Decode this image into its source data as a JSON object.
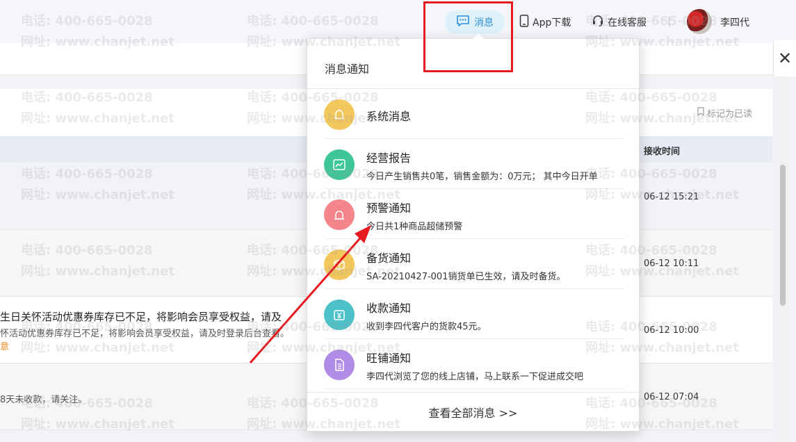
{
  "topbar": {
    "message_label": "消息",
    "app_label": "App下载",
    "service_label": "在线客服",
    "username": "李四代"
  },
  "page": {
    "mark_read": "标记为已读",
    "col_time": "接收时间",
    "rows": [
      {
        "title": "",
        "desc": "",
        "link": "",
        "time": "06-12 15:21"
      },
      {
        "title": "",
        "desc": "",
        "link": "",
        "time": "06-12 10:11"
      },
      {
        "title": "生日关怀活动优惠券库存已不足，将影响会员享受权益，请及",
        "desc": "怀活动优惠券库存已不足，将影响会员享受权益，请及时登录后台查看。",
        "link": "意",
        "time": "06-12 10:00"
      },
      {
        "title": "",
        "desc": "8天未收款，请关注。",
        "link": "",
        "time": "06-12 07:04"
      }
    ]
  },
  "watermark": {
    "phone": "电话: 400-665-0028",
    "site": "网址: www.chanjet.net"
  },
  "popup": {
    "title": "消息通知",
    "items": [
      {
        "title": "系统消息",
        "desc": "",
        "color": "#f2c75c",
        "icon": "bell-icon"
      },
      {
        "title": "经营报告",
        "desc": "今日产生销售共0笔，销售金额为：0万元；  其中今日开单",
        "color": "#3ec59a",
        "icon": "chart-icon"
      },
      {
        "title": "预警通知",
        "desc": "今日共1种商品超储预警",
        "color": "#f4858a",
        "icon": "alarm-icon"
      },
      {
        "title": "备货通知",
        "desc": "SA-20210427-001销货单已生效，请及时备货。",
        "color": "#f2c75c",
        "icon": "box-icon"
      },
      {
        "title": "收款通知",
        "desc": "收到李四代客户的货款45元。",
        "color": "#4cc1c7",
        "icon": "money-icon"
      },
      {
        "title": "旺铺通知",
        "desc": "李四代浏览了您的线上店铺，马上联系一下促进成交吧",
        "color": "#b08ce6",
        "icon": "document-icon"
      }
    ],
    "view_all": "查看全部消息 >>"
  }
}
